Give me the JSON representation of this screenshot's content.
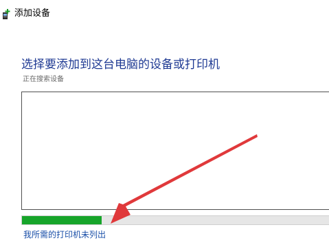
{
  "window": {
    "title": "添加设备",
    "icon": "printer-plus-icon"
  },
  "main": {
    "heading": "选择要添加到这台电脑的设备或打印机",
    "status": "正在搜索设备",
    "device_list": [],
    "progress": 0.26,
    "link_label": "我所需的打印机未列出"
  },
  "annotation": {
    "arrow_color": "#e0393b"
  },
  "colors": {
    "heading": "#1f3a93",
    "progress_fill": "#17a52a",
    "link": "#1a4fa8"
  }
}
